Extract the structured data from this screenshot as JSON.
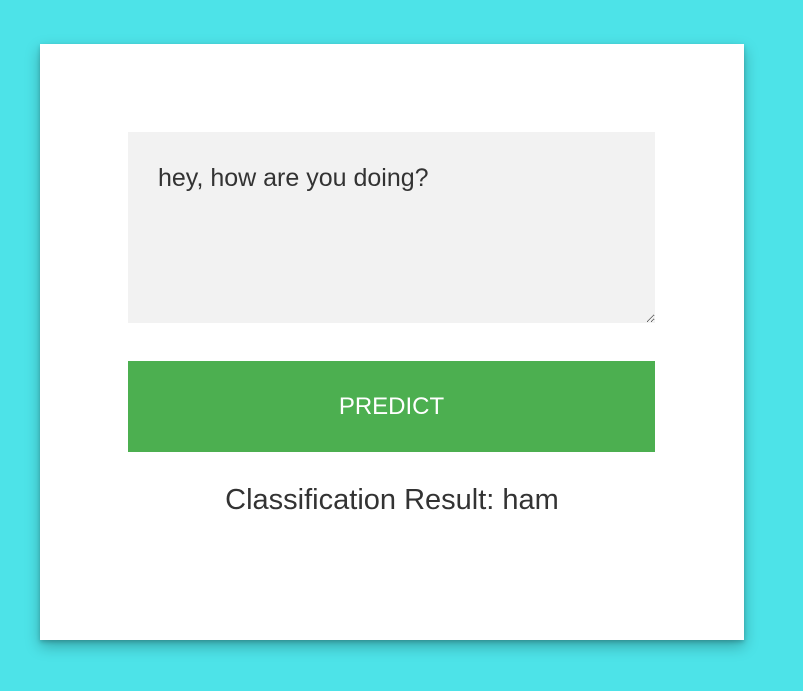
{
  "form": {
    "message_value": "hey, how are you doing?",
    "button_label": "PREDICT"
  },
  "result": {
    "label": "Classification Result: ",
    "value": "ham"
  },
  "colors": {
    "page_background": "#4de3e8",
    "card_background": "#ffffff",
    "textarea_background": "#f2f2f2",
    "button_background": "#4caf50",
    "button_text": "#ffffff",
    "body_text": "#333333"
  }
}
